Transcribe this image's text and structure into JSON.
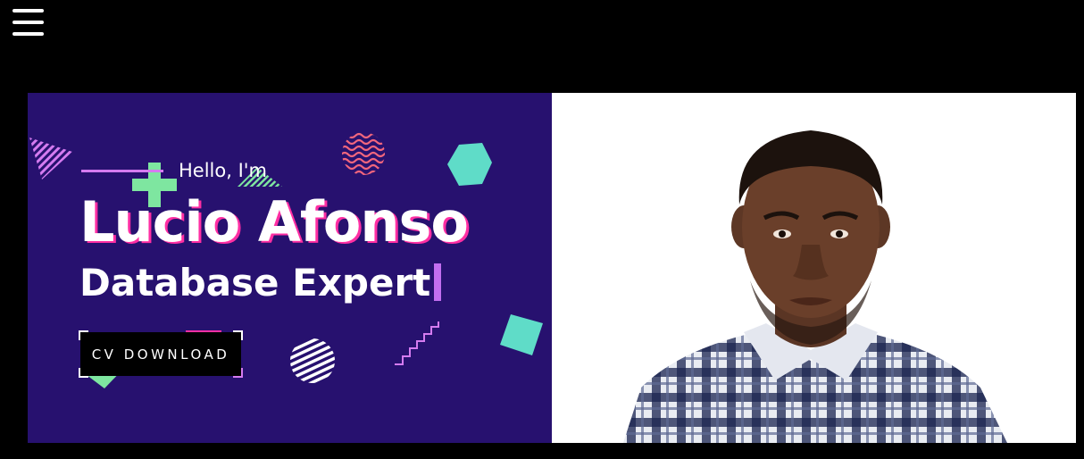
{
  "nav": {
    "menu_icon": "hamburger-menu-icon"
  },
  "hero": {
    "greeting": "Hello, I'm",
    "name": "Lucio Afonso",
    "role": "Database Expert",
    "cv_button_label": "CV DOWNLOAD",
    "photo_icon": "portrait-photo"
  },
  "colors": {
    "page_background": "#000000",
    "hero_panel": "#27116f",
    "accent_pink": "#ff2fa3",
    "accent_purple": "#d57bf0",
    "accent_green": "#7ee6a0",
    "accent_teal": "#5fdcc8",
    "accent_coral": "#f2667d"
  }
}
